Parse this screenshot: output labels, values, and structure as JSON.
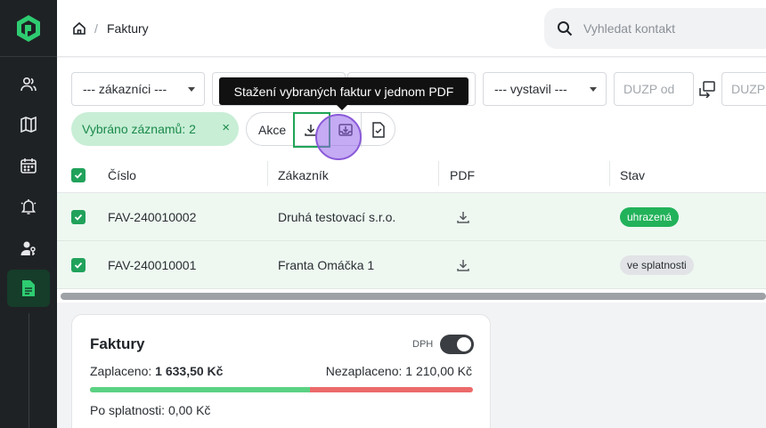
{
  "header": {
    "breadcrumb_current": "Faktury",
    "breadcrumb_separator": "/",
    "search_placeholder": "Vyhledat kontakt"
  },
  "filters": {
    "customers": "--- zákazníci ---",
    "issued_by": "--- vystavil ---",
    "duzp_from": "DUZP od",
    "duzp_to": "DUZP"
  },
  "tooltip": "Stažení vybraných faktur v jednom PDF",
  "selection": {
    "label": "Vybráno záznamů: 2",
    "close": "×"
  },
  "actions": {
    "label": "Akce"
  },
  "table": {
    "columns": [
      "Číslo",
      "Zákazník",
      "PDF",
      "Stav"
    ],
    "rows": [
      {
        "number": "FAV-240010002",
        "customer": "Druhá testovací s.r.o.",
        "status": "uhrazená"
      },
      {
        "number": "FAV-240010001",
        "customer": "Franta Omáčka 1",
        "status": "ve splatnosti"
      }
    ]
  },
  "summary": {
    "title": "Faktury",
    "vat_label": "DPH",
    "vat_enabled": true,
    "paid_label": "Zaplaceno:",
    "paid_value": "1 633,50 Kč",
    "unpaid_label": "Nezaplaceno:",
    "unpaid_value": "1 210,00 Kč",
    "paid_fraction": 0.574,
    "overdue_label": "Po splatnosti:",
    "overdue_value": "0,00 Kč"
  },
  "colors": {
    "brand_green": "#21a25b",
    "sidebar_bg": "#1f2225",
    "paid_badge": "#22b25a",
    "progress_paid": "#5bd283",
    "progress_unpaid": "#ec6a6a"
  }
}
